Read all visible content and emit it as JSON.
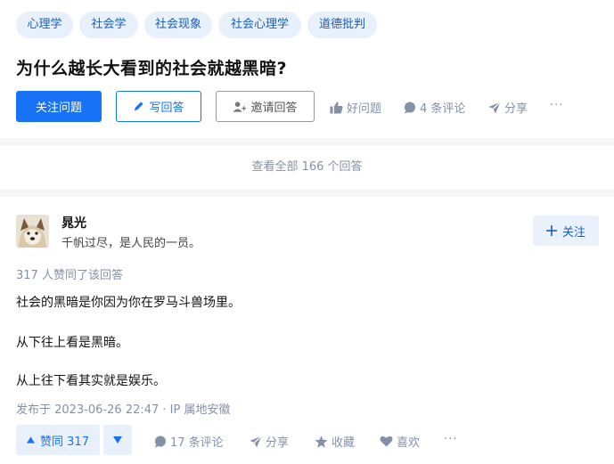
{
  "topics": [
    "心理学",
    "社会学",
    "社会现象",
    "社会心理学",
    "道德批判"
  ],
  "question": {
    "title": "为什么越长大看到的社会就越黑暗?",
    "follow_label": "关注问题",
    "write_label": "写回答",
    "invite_label": "邀请回答",
    "good_question_label": "好问题",
    "comments_label": "4 条评论",
    "share_label": "分享",
    "more_label": "···"
  },
  "view_all": "查看全部 166 个回答",
  "answer": {
    "author_name": "晁光",
    "author_bio": "千帆过尽，是人民的一员。",
    "follow_label": "关注",
    "upvote_summary": "317 人赞同了该回答",
    "paragraphs": [
      "社会的黑暗是你因为你在罗马斗兽场里。",
      "从下往上看是黑暗。",
      "从上往下看其实就是娱乐。"
    ],
    "published": "发布于 2023-06-26 22:47 · IP 属地安徽",
    "vote_label": "赞同 317",
    "comments_label": "17 条评论",
    "share_label": "分享",
    "collect_label": "收藏",
    "like_label": "喜欢",
    "more_label": "···"
  },
  "colors": {
    "brand_blue": "#1772f6",
    "muted": "#8590a6",
    "tag_bg": "#e8f0fb"
  }
}
